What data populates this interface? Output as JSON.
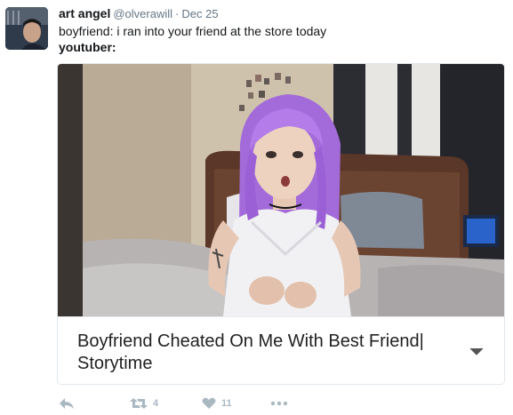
{
  "tweet": {
    "author_name": "art angel",
    "author_handle": "@olverawill",
    "separator": "·",
    "date": "Dec 25",
    "text_line1": "boyfriend: i ran into your friend at the store today",
    "text_line2": "youtuber:"
  },
  "media": {
    "video_title": "Boyfriend Cheated On Me With Best Friend| Storytime"
  },
  "actions": {
    "reply_icon": "reply-icon",
    "retweet_icon": "retweet-icon",
    "retweet_count": "4",
    "like_icon": "heart-icon",
    "like_count": "11",
    "more_icon": "more-dots-icon"
  },
  "colors": {
    "action_gray": "#aab8c2",
    "handle_gray": "#657786",
    "hair_purple": "#a36bd9"
  }
}
